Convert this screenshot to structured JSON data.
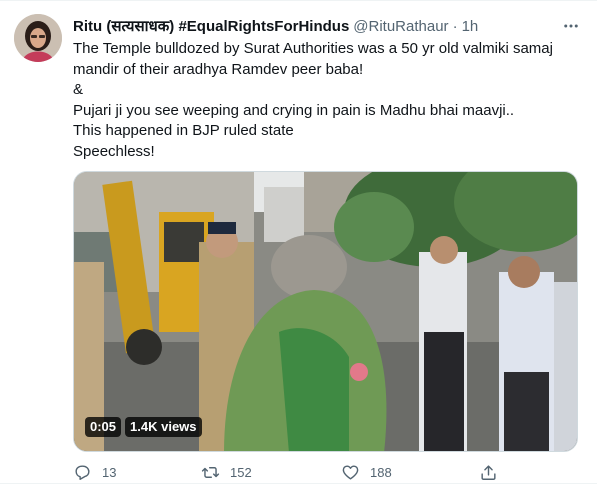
{
  "tweet": {
    "author_name": "Ritu (सत्यसाधक) #EqualRightsForHindus",
    "handle": "@RituRathaur",
    "separator": "·",
    "time": "1h",
    "text_lines": [
      "The Temple bulldozed by Surat Authorities was a 50 yr old valmiki samaj",
      "mandir of their aradhya Ramdev peer baba!",
      "&",
      "Pujari ji you see weeping and crying in pain is Madhu bhai maavji..",
      "This happened in BJP ruled state",
      "Speechless!"
    ],
    "video": {
      "duration": "0:05",
      "views": "1.4K views"
    },
    "actions": {
      "replies": "13",
      "retweets": "152",
      "likes": "188"
    }
  },
  "colors": {
    "text": "#0f1419",
    "secondary": "#536471",
    "border": "#cfd9de"
  },
  "icons": [
    "more-icon",
    "reply-icon",
    "retweet-icon",
    "like-icon",
    "share-icon"
  ]
}
